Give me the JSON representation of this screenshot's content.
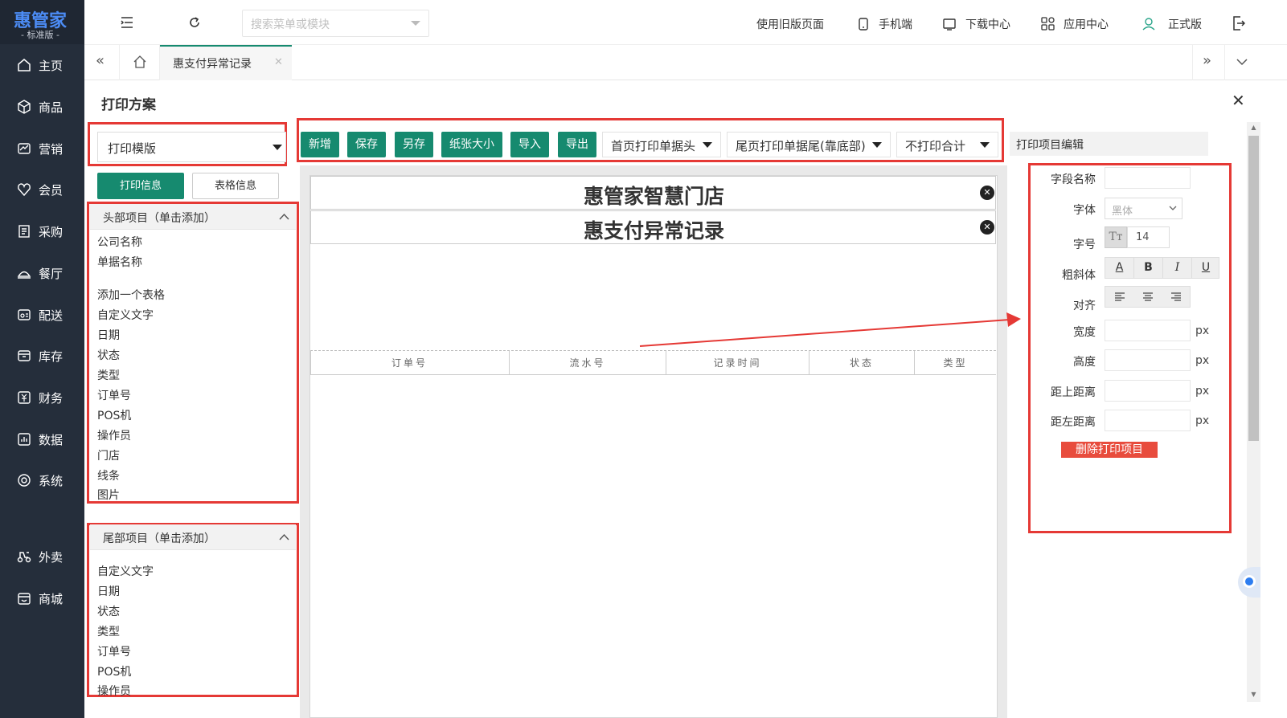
{
  "logo": {
    "brand": "惠管家",
    "edition": "- 标准版 -"
  },
  "sidebar": {
    "items": [
      {
        "label": "主页",
        "icon": "home-icon"
      },
      {
        "label": "商品",
        "icon": "box-icon"
      },
      {
        "label": "营销",
        "icon": "chart-card-icon"
      },
      {
        "label": "会员",
        "icon": "heart-shield-icon"
      },
      {
        "label": "采购",
        "icon": "receipt-icon"
      },
      {
        "label": "餐厅",
        "icon": "dish-icon"
      },
      {
        "label": "配送",
        "icon": "delivery-icon"
      },
      {
        "label": "库存",
        "icon": "warehouse-icon"
      },
      {
        "label": "财务",
        "icon": "finance-icon"
      },
      {
        "label": "数据",
        "icon": "data-icon"
      },
      {
        "label": "系统",
        "icon": "settings-icon"
      },
      {
        "label": "外卖",
        "icon": "scooter-icon"
      },
      {
        "label": "商城",
        "icon": "store-icon"
      }
    ]
  },
  "topbar": {
    "search_placeholder": "搜索菜单或模块",
    "old_version": "使用旧版页面",
    "mobile": "手机端",
    "download_center": "下载中心",
    "app_center": "应用中心",
    "official": "正式版"
  },
  "tabs": {
    "active_tab": "惠支付异常记录"
  },
  "page": {
    "title": "打印方案"
  },
  "left": {
    "template_select": "打印模版",
    "btn_print_info": "打印信息",
    "btn_table_info": "表格信息",
    "header_section": "头部项目（单击添加）",
    "header_items": [
      "公司名称",
      "单据名称",
      "添加一个表格",
      "自定义文字",
      "日期",
      "状态",
      "类型",
      "订单号",
      "POS机",
      "操作员",
      "门店",
      "线条",
      "图片"
    ],
    "footer_section": "尾部项目（单击添加）",
    "footer_items": [
      "自定义文字",
      "日期",
      "状态",
      "类型",
      "订单号",
      "POS机",
      "操作员"
    ]
  },
  "toolbar": {
    "new": "新增",
    "save": "保存",
    "save_as": "另存",
    "paper_size": "纸张大小",
    "import": "导入",
    "export": "导出",
    "first_page_header": "首页打印单据头",
    "last_page_footer": "尾页打印单据尾(靠底部)",
    "no_total": "不打印合计"
  },
  "canvas": {
    "line1": "惠管家智慧门店",
    "line2": "惠支付异常记录",
    "columns": [
      "订单号",
      "流水号",
      "记录时间",
      "状态",
      "类型"
    ]
  },
  "editor": {
    "title": "打印项目编辑",
    "field_name": "字段名称",
    "font": "字体",
    "font_value": "黑体",
    "size": "字号",
    "size_value": "14",
    "style": "粗斜体",
    "align": "对齐",
    "width": "宽度",
    "height": "高度",
    "top": "距上距离",
    "left": "距左距离",
    "unit": "px",
    "delete": "删除打印项目"
  },
  "colors": {
    "sidebar": "#252e3b",
    "accent": "#168a6f",
    "highlight": "#e53935",
    "brand": "#4c8cf5"
  }
}
